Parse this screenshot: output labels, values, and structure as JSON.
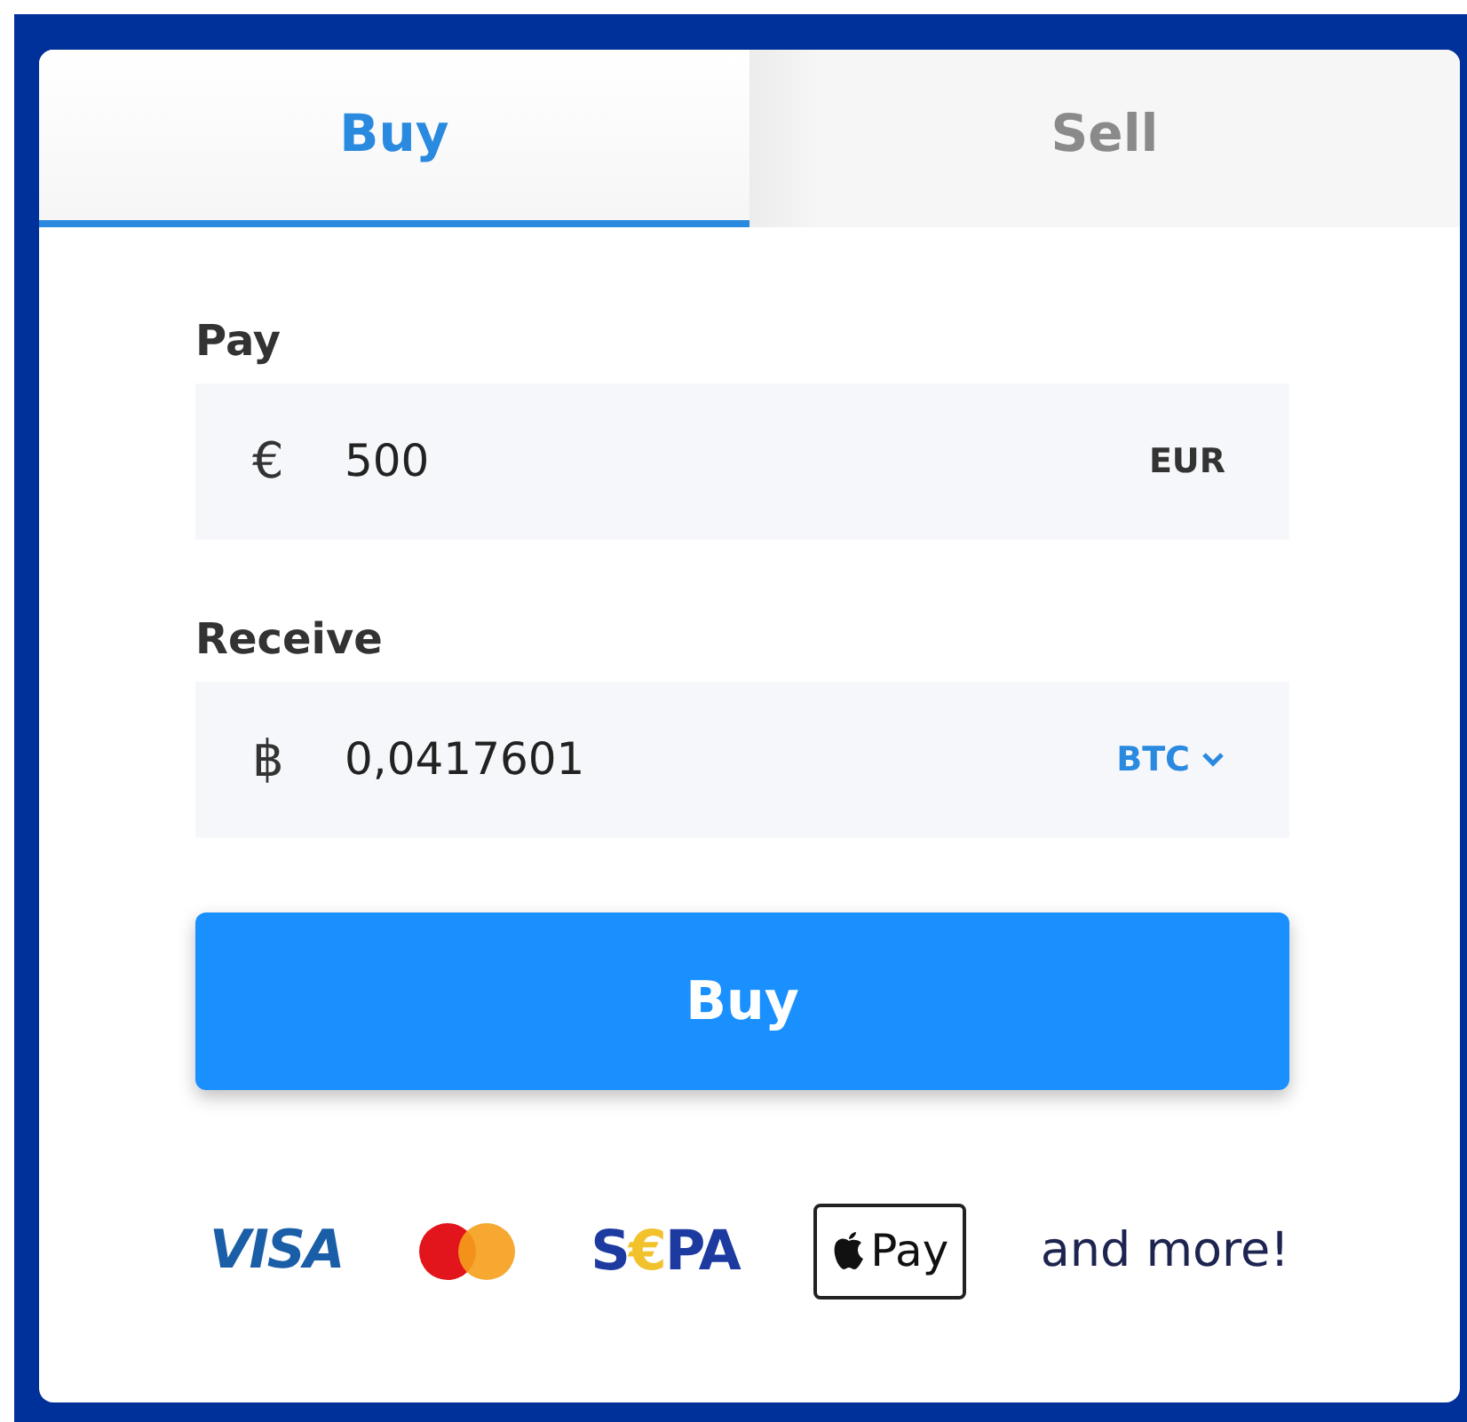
{
  "tabs": [
    {
      "label": "Buy",
      "selected": true
    },
    {
      "label": "Sell",
      "selected": false
    }
  ],
  "pay": {
    "label": "Pay",
    "symbol": "€",
    "value": "500",
    "currency": "EUR",
    "dropdown": false
  },
  "receive": {
    "label": "Receive",
    "symbol": "฿",
    "value": "0,0417601",
    "currency": "BTC",
    "dropdown": true
  },
  "submit": "Buy",
  "payment_methods": [
    {
      "kind": "visa",
      "label": "VISA"
    },
    {
      "kind": "mastercard"
    },
    {
      "kind": "sepa",
      "label": "S€PA"
    },
    {
      "kind": "applepay",
      "label": "Pay"
    },
    {
      "kind": "text",
      "label": "and more!"
    }
  ]
}
